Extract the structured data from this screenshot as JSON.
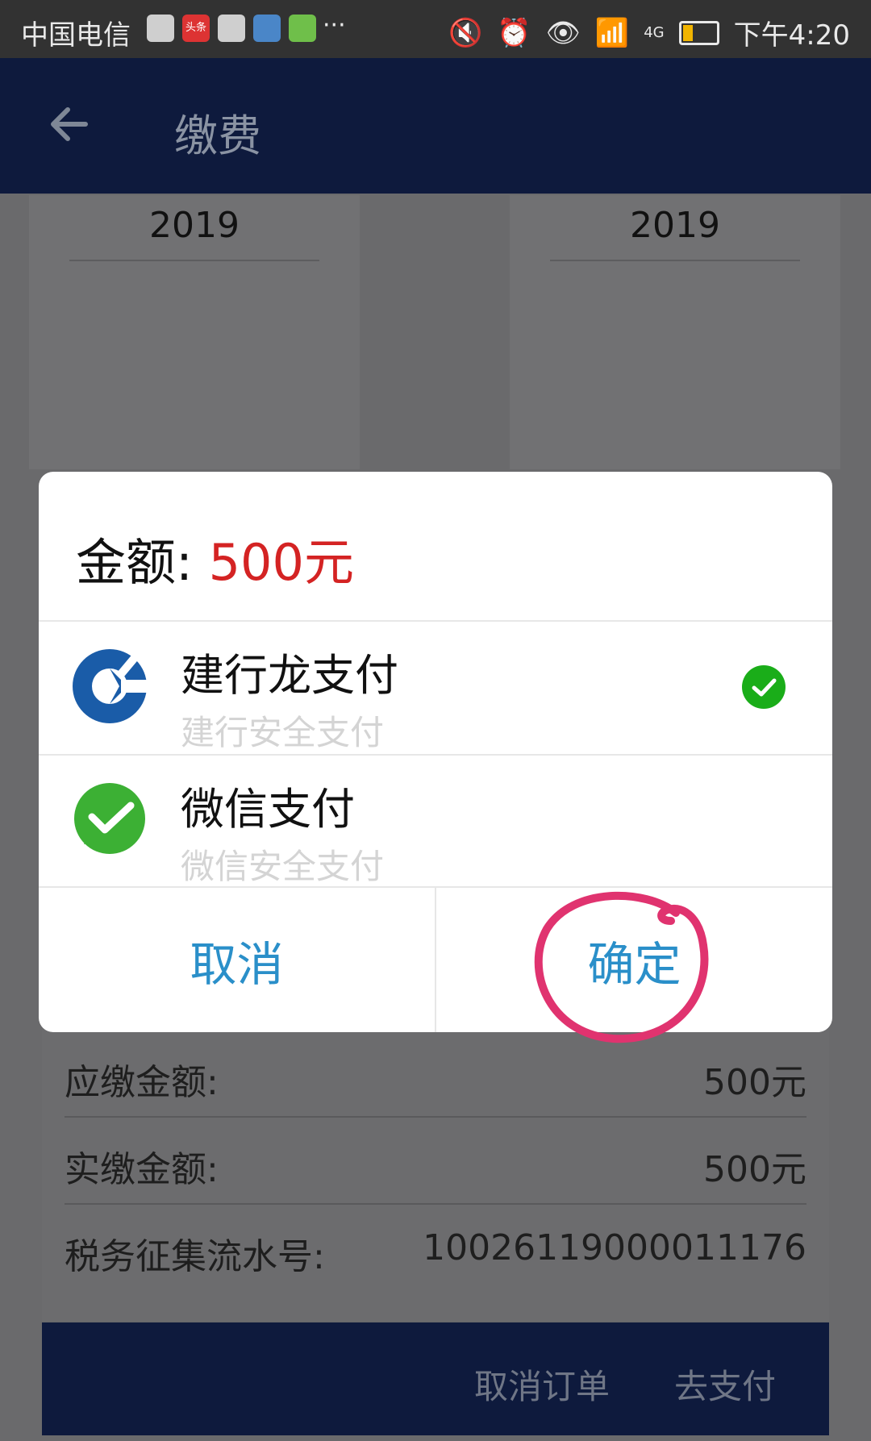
{
  "status_bar": {
    "carrier": "中国电信",
    "app_badge": "头条",
    "more": "···",
    "network": "4G",
    "time": "下午4:20"
  },
  "header": {
    "title": "缴费"
  },
  "background": {
    "years": [
      "2019",
      "2019"
    ],
    "rows": [
      {
        "label": "应缴金额:",
        "value": "500元"
      },
      {
        "label": "实缴金额:",
        "value": "500元"
      },
      {
        "label": "税务征集流水号:",
        "value": "10026119000011176"
      }
    ],
    "bottom": {
      "cancel_order": "取消订单",
      "go_pay": "去支付"
    }
  },
  "dialog": {
    "amount_label": "金额: ",
    "amount_value": "500元",
    "options": [
      {
        "name": "建行龙支付",
        "desc": "建行安全支付",
        "selected": true
      },
      {
        "name": "微信支付",
        "desc": "微信安全支付",
        "selected": false
      }
    ],
    "cancel": "取消",
    "confirm": "确定"
  },
  "colors": {
    "header_bg": "#0e1a3d",
    "amount": "#d42323",
    "dialog_button": "#2a8fc9",
    "check": "#1aad19",
    "annotation": "#e0336f"
  }
}
